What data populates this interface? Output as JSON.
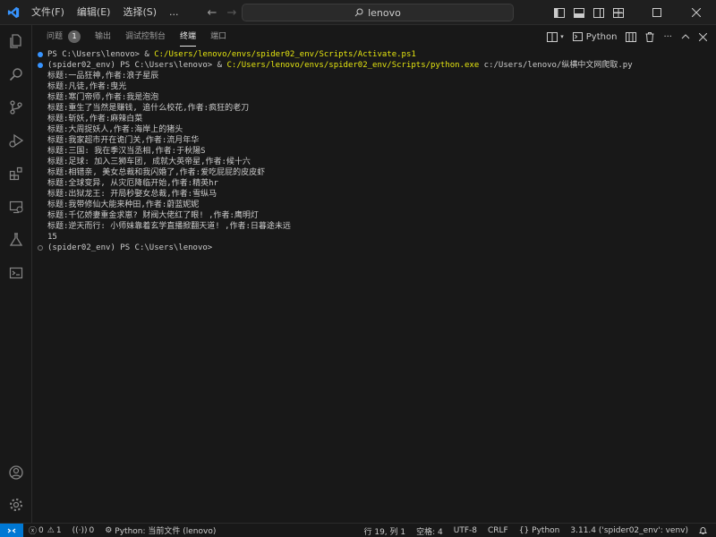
{
  "menu": [
    "文件(F)",
    "编辑(E)",
    "选择(S)",
    "..."
  ],
  "command_center": {
    "text": "lenovo"
  },
  "panel_tabs": [
    {
      "label": "问题",
      "badge": "1"
    },
    {
      "label": "输出"
    },
    {
      "label": "调试控制台"
    },
    {
      "label": "终端",
      "active": true
    },
    {
      "label": "端口"
    }
  ],
  "terminal_profile": "Python",
  "terminal": {
    "line1": {
      "prompt": "PS C:\\Users\\lenovo> & ",
      "path": "C:/Users/lenovo/envs/spider02_env/Scripts/Activate.ps1"
    },
    "line2": {
      "prompt": "(spider02_env) PS C:\\Users\\lenovo> & ",
      "path": "C:/Users/lenovo/envs/spider02_env/Scripts/python.exe",
      "rest": " c:/Users/lenovo/纵横中文网爬取.py"
    },
    "output": [
      "标题:一品狂神,作者:浪子星辰",
      "标题:凡徒,作者:曳光",
      "标题:寒门帝师,作者:我是泡泡",
      "标题:重生了当然是赚钱, 追什么校花,作者:疯狂的老刀",
      "标题:斩妖,作者:麻辣白菜",
      "标题:大周捉妖人,作者:海岸上的猪头",
      "标题:我家超市开在诡门关,作者:流月年华",
      "标题:三国: 我在季汉当丞相,作者:于秋陽S",
      "标题:足球: 加入三狮车团, 成就大英帝星,作者:候十六",
      "标题:相错亲, 美女总裁和我闪婚了,作者:爱吃屁屁的皮皮虾",
      "标题:全球变异, 从灾厄降临开始,作者:精英hr",
      "标题:出狱龙王: 开局秒娶女总裁,作者:雪纵马",
      "标题:我带修仙大能来种田,作者:蔚蓝妮妮",
      "标题:千亿娇妻重金求崽? 财阀大佬红了眼! ,作者:鹰明灯",
      "标题:逆天而行: 小师妹靠着玄学直播掀翻天道! ,作者:日暮途未远",
      "15"
    ],
    "final_prompt": "(spider02_env) PS C:\\Users\\lenovo>"
  },
  "status": {
    "errors": "0",
    "warnings": "1",
    "ports": "0",
    "python_file": "Python: 当前文件 (lenovo)",
    "cursor": "行 19, 列 1",
    "spaces": "空格: 4",
    "encoding": "UTF-8",
    "eol": "CRLF",
    "language": "Python",
    "interpreter": "3.11.4 ('spider02_env': venv)"
  },
  "colors": {
    "accent": "#0078d4",
    "path_yellow": "#e5e510",
    "dot_blue": "#3794ff"
  }
}
